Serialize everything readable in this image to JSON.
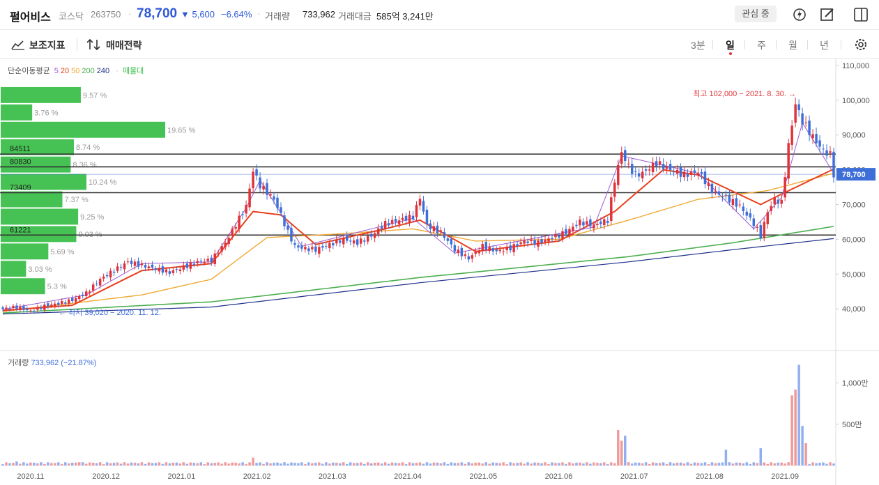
{
  "header": {
    "name": "펄어비스",
    "market": "코스닥",
    "code": "263750",
    "price": "78,700",
    "change": "▼ 5,600",
    "change_pct": "−6.64%",
    "separator": "·",
    "volume_label": "거래량",
    "volume_value": "733,962",
    "amount_label": "거래대금",
    "amount_value": "585억 3,241만",
    "watch_label": "관심 중"
  },
  "toolbar": {
    "indicators_label": "보조지표",
    "strategy_label": "매매전략",
    "periods": [
      "3분",
      "일",
      "주",
      "월",
      "년"
    ],
    "active_period": "일"
  },
  "legend": {
    "ma_label": "단순이동평균",
    "ma_periods": [
      {
        "label": "5",
        "color": "#9b59d0"
      },
      {
        "label": "20",
        "color": "#e8401c"
      },
      {
        "label": "50",
        "color": "#f0a830"
      },
      {
        "label": "200",
        "color": "#4caf50"
      },
      {
        "label": "240",
        "color": "#1f2f8a"
      }
    ],
    "dot": "·",
    "volume_profile_label": "매물대",
    "volume_profile_color": "#3bbf4a"
  },
  "colors": {
    "up": "#e0323a",
    "down": "#3e6fd8",
    "up_volume": "#ef9a9a",
    "down_volume": "#90aef0",
    "price_tag": "#3e6fd8"
  },
  "chart_data": {
    "type": "candlestick",
    "x_ticks": [
      "2020.11",
      "2020.12",
      "2021.01",
      "2021.02",
      "2021.03",
      "2021.04",
      "2021.05",
      "2021.06",
      "2021.07",
      "2021.08",
      "2021.09"
    ],
    "y_ticks": [
      "110,000",
      "100,000",
      "90,000",
      "80,000",
      "70,000",
      "60,000",
      "50,000",
      "40,000"
    ],
    "ylim": [
      29000,
      112000
    ],
    "current_price_label": "78,700",
    "current_price": 78700,
    "high_annotation": "최고 102,000 − 2021. 8. 30. →",
    "low_annotation": "← 최저 39,020 − 2020. 11. 12.",
    "high": 102000,
    "low": 39020,
    "volume_profile": [
      {
        "top": 104000,
        "bottom": 99000,
        "pct_value": 9.57,
        "pct": "9.57 %"
      },
      {
        "top": 99000,
        "bottom": 94000,
        "pct_value": 3.76,
        "pct": "3.76 %"
      },
      {
        "top": 94000,
        "bottom": 89000,
        "pct_value": 19.65,
        "pct": "19.65 %"
      },
      {
        "top": 89000,
        "bottom": 84000,
        "pct_value": 8.74,
        "pct": "8.74 %"
      },
      {
        "top": 84000,
        "bottom": 79000,
        "pct_value": 8.36,
        "pct": "8.36 %"
      },
      {
        "top": 79000,
        "bottom": 74000,
        "pct_value": 10.24,
        "pct": "10.24 %"
      },
      {
        "top": 74000,
        "bottom": 69000,
        "pct_value": 7.37,
        "pct": "7.37 %"
      },
      {
        "top": 69000,
        "bottom": 64000,
        "pct_value": 9.25,
        "pct": "9.25 %"
      },
      {
        "top": 64000,
        "bottom": 59000,
        "pct_value": 9.03,
        "pct": "9.03 %"
      },
      {
        "top": 59000,
        "bottom": 54000,
        "pct_value": 5.69,
        "pct": "5.69 %"
      },
      {
        "top": 54000,
        "bottom": 49000,
        "pct_value": 3.03,
        "pct": "3.03 %"
      },
      {
        "top": 49000,
        "bottom": 44000,
        "pct_value": 5.3,
        "pct": "5.3 %"
      }
    ],
    "support_lines": [
      {
        "value": 84511,
        "label": "84511"
      },
      {
        "value": 80830,
        "label": "80830"
      },
      {
        "value": 73409,
        "label": "73409"
      },
      {
        "value": 61221,
        "label": "61221"
      }
    ],
    "close_key": [
      [
        0,
        40000
      ],
      [
        4,
        40500
      ],
      [
        8,
        39300
      ],
      [
        12,
        40800
      ],
      [
        16,
        41500
      ],
      [
        20,
        42500
      ],
      [
        24,
        44500
      ],
      [
        28,
        48500
      ],
      [
        32,
        51000
      ],
      [
        36,
        53500
      ],
      [
        40,
        52500
      ],
      [
        44,
        51500
      ],
      [
        48,
        50500
      ],
      [
        52,
        52000
      ],
      [
        56,
        53500
      ],
      [
        60,
        54000
      ],
      [
        64,
        59000
      ],
      [
        68,
        66000
      ],
      [
        70,
        69500
      ],
      [
        72,
        79800
      ],
      [
        74,
        75500
      ],
      [
        76,
        73500
      ],
      [
        78,
        71500
      ],
      [
        80,
        67000
      ],
      [
        82,
        62000
      ],
      [
        84,
        58000
      ],
      [
        86,
        57500
      ],
      [
        90,
        57000
      ],
      [
        94,
        58500
      ],
      [
        98,
        60000
      ],
      [
        102,
        59000
      ],
      [
        106,
        61000
      ],
      [
        110,
        64500
      ],
      [
        114,
        65500
      ],
      [
        118,
        66500
      ],
      [
        120,
        72000
      ],
      [
        122,
        64000
      ],
      [
        126,
        62000
      ],
      [
        130,
        57000
      ],
      [
        134,
        54500
      ],
      [
        138,
        58000
      ],
      [
        142,
        56500
      ],
      [
        146,
        57500
      ],
      [
        150,
        59500
      ],
      [
        154,
        59000
      ],
      [
        158,
        60500
      ],
      [
        162,
        62000
      ],
      [
        166,
        65000
      ],
      [
        170,
        64000
      ],
      [
        174,
        65500
      ],
      [
        176,
        77000
      ],
      [
        178,
        85000
      ],
      [
        180,
        81000
      ],
      [
        182,
        78500
      ],
      [
        184,
        79000
      ],
      [
        188,
        82000
      ],
      [
        192,
        80000
      ],
      [
        196,
        78500
      ],
      [
        200,
        79500
      ],
      [
        204,
        74000
      ],
      [
        208,
        72000
      ],
      [
        212,
        69500
      ],
      [
        216,
        64500
      ],
      [
        218,
        61000
      ],
      [
        220,
        68000
      ],
      [
        222,
        71500
      ],
      [
        224,
        70500
      ],
      [
        226,
        87000
      ],
      [
        228,
        99000
      ],
      [
        230,
        94000
      ],
      [
        232,
        91000
      ],
      [
        234,
        88000
      ],
      [
        236,
        85500
      ],
      [
        238,
        84300
      ],
      [
        239,
        78700
      ]
    ],
    "n_days": 240,
    "ma5": [
      [
        0,
        39800
      ],
      [
        24,
        44000
      ],
      [
        40,
        53000
      ],
      [
        60,
        53500
      ],
      [
        70,
        69000
      ],
      [
        74,
        77000
      ],
      [
        86,
        58000
      ],
      [
        118,
        66000
      ],
      [
        130,
        56000
      ],
      [
        170,
        63500
      ],
      [
        178,
        84000
      ],
      [
        200,
        79000
      ],
      [
        216,
        63000
      ],
      [
        224,
        72000
      ],
      [
        230,
        93500
      ],
      [
        239,
        79000
      ]
    ],
    "ma20": [
      [
        0,
        39500
      ],
      [
        20,
        41000
      ],
      [
        40,
        51000
      ],
      [
        60,
        53000
      ],
      [
        72,
        68000
      ],
      [
        80,
        67000
      ],
      [
        90,
        58500
      ],
      [
        110,
        63000
      ],
      [
        120,
        65500
      ],
      [
        136,
        56500
      ],
      [
        160,
        59500
      ],
      [
        176,
        68000
      ],
      [
        190,
        80000
      ],
      [
        200,
        78500
      ],
      [
        218,
        70000
      ],
      [
        224,
        73000
      ],
      [
        239,
        80200
      ]
    ],
    "ma50": [
      [
        0,
        39200
      ],
      [
        40,
        44000
      ],
      [
        60,
        48500
      ],
      [
        76,
        60500
      ],
      [
        96,
        61500
      ],
      [
        118,
        63000
      ],
      [
        136,
        59500
      ],
      [
        160,
        60000
      ],
      [
        180,
        65500
      ],
      [
        200,
        71500
      ],
      [
        220,
        74000
      ],
      [
        239,
        79000
      ]
    ],
    "ma200": [
      [
        0,
        38800
      ],
      [
        60,
        42000
      ],
      [
        120,
        49000
      ],
      [
        180,
        55000
      ],
      [
        210,
        59000
      ],
      [
        239,
        63700
      ]
    ],
    "ma240": [
      [
        0,
        38500
      ],
      [
        60,
        40500
      ],
      [
        120,
        47500
      ],
      [
        180,
        53500
      ],
      [
        210,
        57000
      ],
      [
        239,
        60200
      ]
    ],
    "volume": {
      "legend_label": "거래량",
      "legend_value": "733,962 (−21.87%)",
      "y_ticks": [
        "1,000만",
        "500만"
      ],
      "ylim": [
        0,
        1250
      ],
      "unit": "만",
      "spikes": [
        [
          4,
          48
        ],
        [
          22,
          40
        ],
        [
          72,
          95
        ],
        [
          177,
          430
        ],
        [
          178,
          300
        ],
        [
          179,
          360
        ],
        [
          208,
          190
        ],
        [
          218,
          210
        ],
        [
          227,
          850
        ],
        [
          228,
          920
        ],
        [
          229,
          1220
        ],
        [
          230,
          480
        ],
        [
          231,
          270
        ]
      ],
      "base": 40
    }
  }
}
